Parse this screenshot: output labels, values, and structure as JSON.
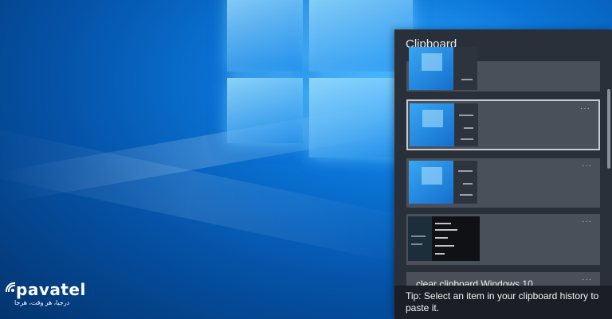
{
  "desktop": {
    "background_colors": [
      "#2fa9ff",
      "#0a74d6",
      "#0553a8",
      "#03346e"
    ]
  },
  "watermark": {
    "brand": "pavatel",
    "tagline": "درجیا، هر وقت، هرجا"
  },
  "clipboard": {
    "title": "Clipboard",
    "panel_color": "#2a3039",
    "card_color": "#4a505a",
    "items": [
      {
        "type": "image",
        "content": "screenshot",
        "more": "···"
      },
      {
        "type": "image",
        "content": "screenshot",
        "selected": true,
        "more": "···"
      },
      {
        "type": "image",
        "content": "screenshot",
        "more": "···"
      },
      {
        "type": "image",
        "content": "command-window",
        "more": "···"
      },
      {
        "type": "text",
        "text": "clear clipboard Windows 10",
        "more": "···"
      }
    ],
    "tip": "Tip: Select an item in your clipboard history to paste it."
  }
}
